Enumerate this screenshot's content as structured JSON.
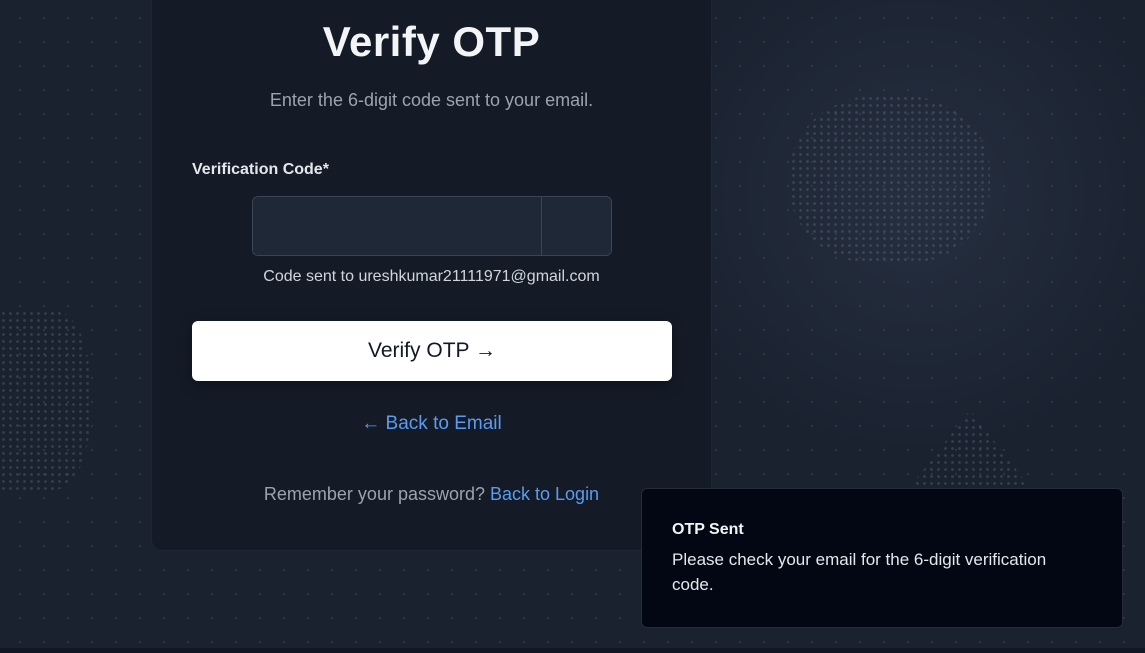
{
  "page": {
    "title": "Verify OTP",
    "subtitle": "Enter the 6-digit code sent to your email."
  },
  "form": {
    "code_label": "Verification Code*",
    "otp_digits": [
      "",
      "",
      "",
      "",
      "",
      ""
    ],
    "code_sent_text": "Code sent to ureshkumar21111971@gmail.com",
    "verify_button_label": "Verify OTP →",
    "back_email_label": "← Back to Email",
    "remember_text": "Remember your password?",
    "back_login_label": "Back to Login"
  },
  "toast": {
    "title": "OTP Sent",
    "message": "Please check your email for the 6-digit verification code."
  },
  "colors": {
    "background": "#1a2230",
    "card": "#141b27",
    "link": "#5b9bf0",
    "button_bg": "#ffffff",
    "toast_bg": "#020713"
  }
}
